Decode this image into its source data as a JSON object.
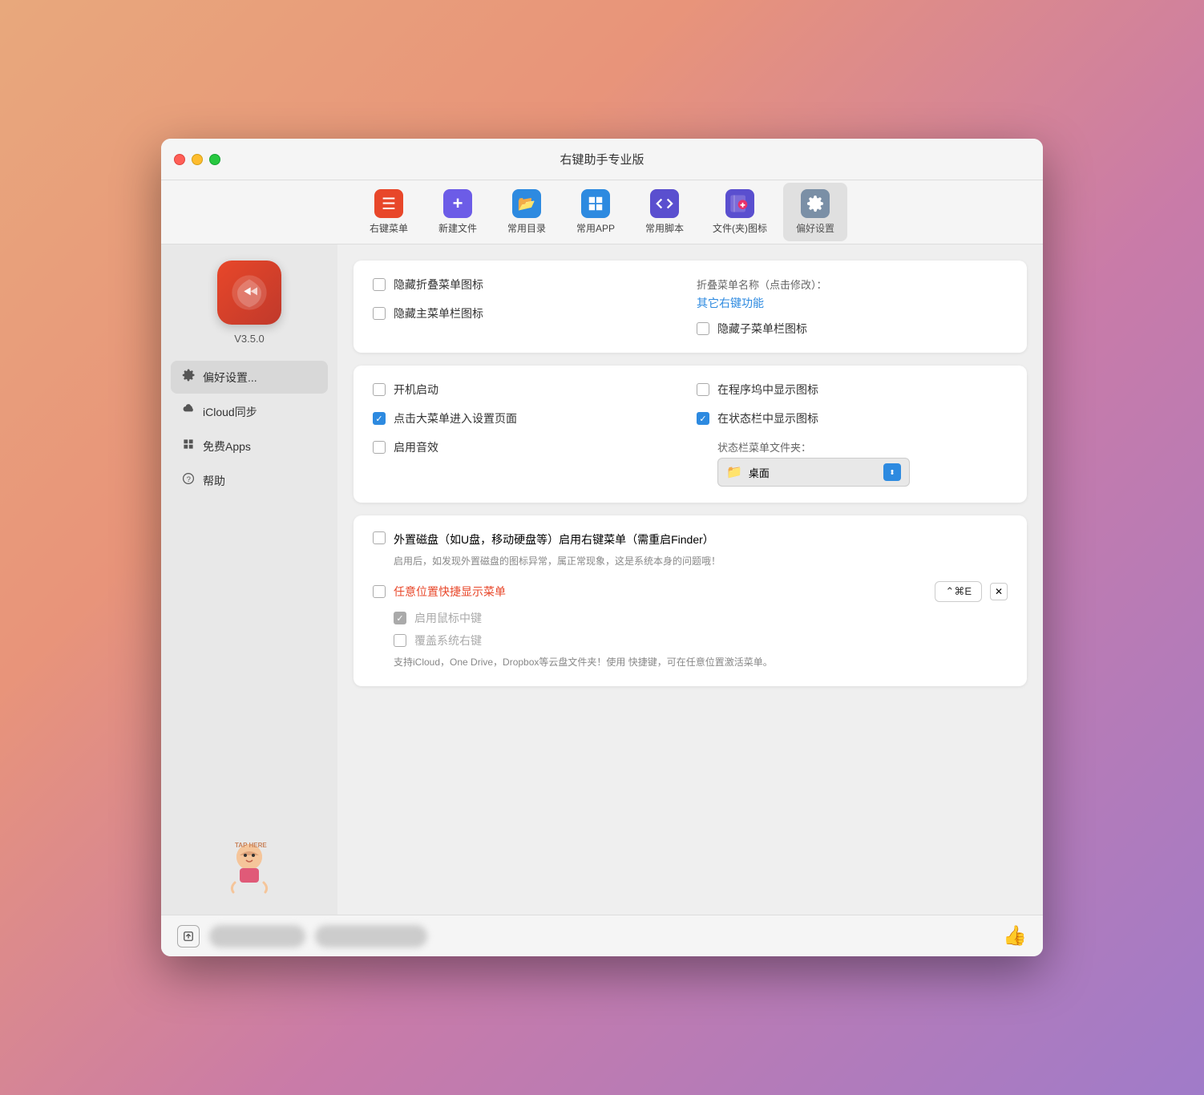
{
  "window": {
    "title": "右键助手专业版"
  },
  "toolbar": {
    "items": [
      {
        "id": "rightmenu",
        "label": "右键菜单",
        "icon_class": "icon-menu",
        "icon_char": "☰"
      },
      {
        "id": "newfile",
        "label": "新建文件",
        "icon_class": "icon-newfile",
        "icon_char": "+"
      },
      {
        "id": "commondir",
        "label": "常用目录",
        "icon_class": "icon-dir",
        "icon_char": "📁"
      },
      {
        "id": "commonapp",
        "label": "常用APP",
        "icon_class": "icon-app",
        "icon_char": "✦"
      },
      {
        "id": "commonscript",
        "label": "常用脚本",
        "icon_class": "icon-script",
        "icon_char": "</>"
      },
      {
        "id": "fileicon",
        "label": "文件(夹)图标",
        "icon_class": "icon-fileicon",
        "icon_char": "♥"
      },
      {
        "id": "preferences",
        "label": "偏好设置",
        "icon_class": "icon-pref",
        "icon_char": "⚙",
        "active": true
      }
    ]
  },
  "sidebar": {
    "app_version": "V3.5.0",
    "nav_items": [
      {
        "id": "preferences",
        "label": "偏好设置...",
        "icon": "⚙",
        "active": true
      },
      {
        "id": "icloud",
        "label": "iCloud同步",
        "icon": "☁"
      },
      {
        "id": "freeapps",
        "label": "免费Apps",
        "icon": "✦"
      },
      {
        "id": "help",
        "label": "帮助",
        "icon": "?"
      }
    ]
  },
  "main": {
    "card1": {
      "hide_fold_icon": {
        "label": "隐藏折叠菜单图标",
        "checked": false
      },
      "hide_main_menubar": {
        "label": "隐藏主菜单栏图标",
        "checked": false
      },
      "fold_name_label": "折叠菜单名称（点击修改）：",
      "fold_name_value": "其它右键功能",
      "hide_submenu_bar": {
        "label": "隐藏子菜单栏图标",
        "checked": false
      }
    },
    "card2": {
      "auto_launch": {
        "label": "开机启动",
        "checked": false
      },
      "show_in_dock": {
        "label": "在程序坞中显示图标",
        "checked": false
      },
      "click_to_settings": {
        "label": "点击大菜单进入设置页面",
        "checked": true
      },
      "show_in_statusbar": {
        "label": "在状态栏中显示图标",
        "checked": true
      },
      "enable_sound": {
        "label": "启用音效",
        "checked": false
      },
      "statusbar_folder_label": "状态栏菜单文件夹：",
      "statusbar_folder_value": "桌面"
    },
    "card3": {
      "external_disk": {
        "label": "外置磁盘（如U盘，移动硬盘等）启用右键菜单（需重启Finder）",
        "checked": false,
        "desc": "启用后，如发现外置磁盘的图标异常，属正常现象，这是系统本身的问题哦！"
      },
      "quick_menu": {
        "label": "任意位置快捷显示菜单",
        "checked": false,
        "shortcut": "⌃⌘E",
        "sub_mouse": {
          "label": "启用鼠标中键",
          "checked": true,
          "disabled": true
        },
        "sub_override": {
          "label": "覆盖系统右键",
          "checked": false
        },
        "support_text": "支持iCloud，One Drive，Dropbox等云盘文件夹！使用\n快捷键，可在任意位置激活菜单。"
      }
    }
  },
  "footer": {
    "export_icon": "↗",
    "like_icon": "👍"
  }
}
